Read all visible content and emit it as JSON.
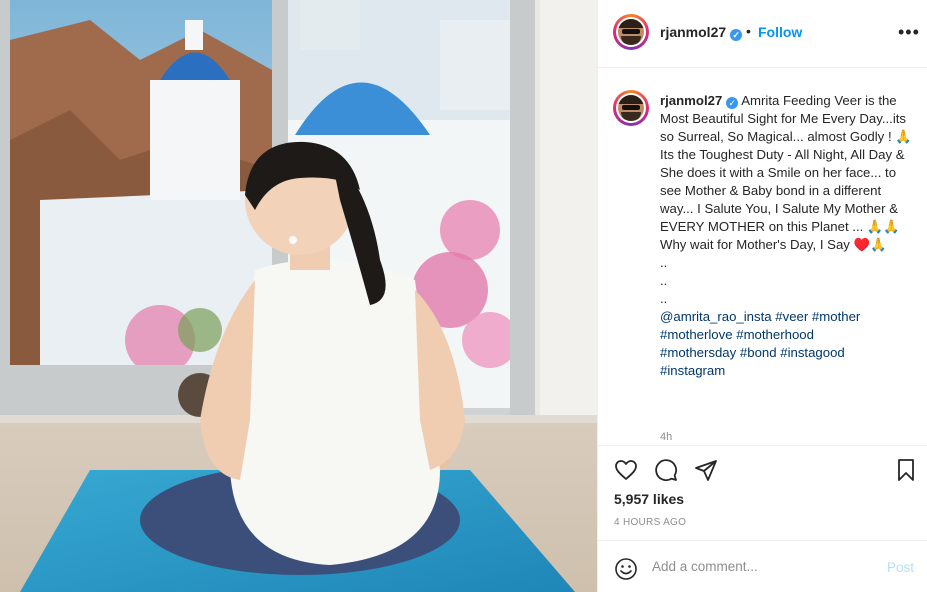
{
  "post": {
    "username": "rjanmol27",
    "verified_mark": "✓",
    "separator": "•",
    "follow_label": "Follow",
    "more_label": "•••",
    "caption_lines": [
      "Amrita Feeding Veer is the Most Beautiful Sight for Me Every Day...its so Surreal, So Magical... almost Godly ! 🙏",
      "Its the Toughest Duty - All Night, All Day & She does it with a Smile on her face... to see Mother & Baby bond in a different way... I Salute You, I Salute My Mother & EVERY MOTHER on this Planet ... 🙏🙏",
      "Why wait for Mother's Day, I Say ♥️🙏",
      "..",
      "..",
      ".."
    ],
    "tags_lines": [
      "@amrita_rao_insta #veer #mother",
      "#motherlove #motherhood",
      "#mothersday #bond #instagood",
      "#instagram"
    ],
    "caption_age": "4h",
    "likes": "5,957 likes",
    "posted_ago": "4 HOURS AGO",
    "comment_placeholder": "Add a comment...",
    "post_label": "Post"
  },
  "icons": {
    "like": "heart-icon",
    "comment": "comment-icon",
    "share": "paper-plane-icon",
    "save": "bookmark-icon",
    "emoji": "smiley-icon"
  },
  "colors": {
    "link_blue": "#0095f6",
    "hashtag": "#00376b",
    "muted": "#8e8e8e",
    "post_disabled": "#b2dffc"
  }
}
